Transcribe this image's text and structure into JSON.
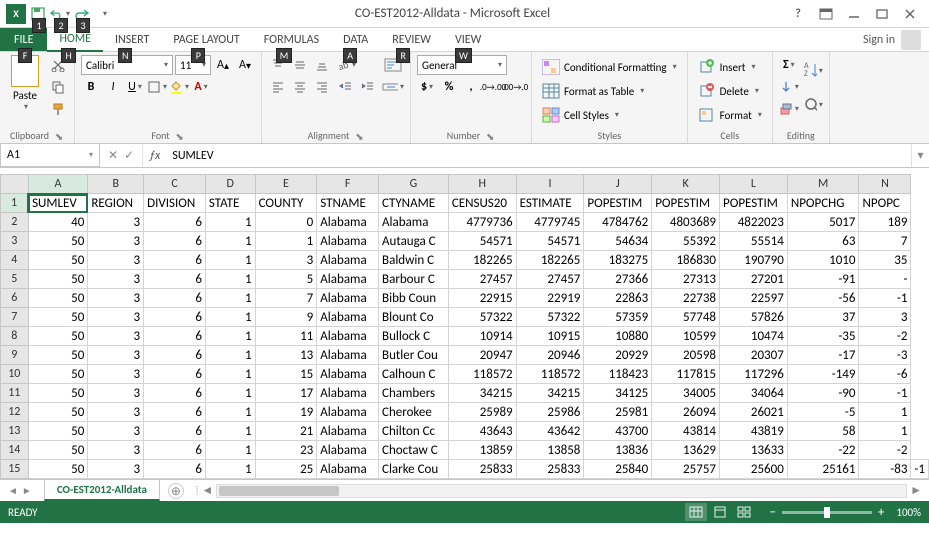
{
  "app": {
    "title": "CO-EST2012-Alldata - Microsoft Excel"
  },
  "qat": {
    "save_key": "1",
    "undo_key": "2",
    "redo_key": "3"
  },
  "tabs": {
    "file": {
      "label": "FILE",
      "key": "F"
    },
    "home": {
      "label": "HOME",
      "key": "H"
    },
    "insert": {
      "label": "INSERT",
      "key": "N"
    },
    "pagelayout": {
      "label": "PAGE LAYOUT",
      "key": "P"
    },
    "formulas": {
      "label": "FORMULAS",
      "key": "M"
    },
    "data": {
      "label": "DATA",
      "key": "A"
    },
    "review": {
      "label": "REVIEW",
      "key": "R"
    },
    "view": {
      "label": "VIEW",
      "key": "W"
    },
    "signin": "Sign in"
  },
  "ribbon": {
    "clipboard": {
      "paste": "Paste",
      "label": "Clipboard"
    },
    "font": {
      "name": "Calibri",
      "size": "11",
      "label": "Font"
    },
    "alignment": {
      "label": "Alignment"
    },
    "number": {
      "format": "General",
      "label": "Number"
    },
    "styles": {
      "cond": "Conditional Formatting",
      "table": "Format as Table",
      "cell": "Cell Styles",
      "label": "Styles"
    },
    "cells": {
      "insert": "Insert",
      "delete": "Delete",
      "format": "Format",
      "label": "Cells"
    },
    "editing": {
      "label": "Editing"
    }
  },
  "namebox": "A1",
  "formula_value": "SUMLEV",
  "columns": [
    "A",
    "B",
    "C",
    "D",
    "E",
    "F",
    "G",
    "H",
    "I",
    "J",
    "K",
    "L",
    "M",
    "N"
  ],
  "header_row": [
    "SUMLEV",
    "REGION",
    "DIVISION",
    "STATE",
    "COUNTY",
    "STNAME",
    "CTYNAME",
    "CENSUS20",
    "ESTIMATE",
    "POPESTIM",
    "POPESTIM",
    "POPESTIM",
    "NPOPCHG",
    "NPOPC"
  ],
  "data_rows": [
    [
      40,
      3,
      6,
      1,
      0,
      "Alabama",
      "Alabama",
      4779736,
      4779745,
      4784762,
      4803689,
      4822023,
      5017,
      "189"
    ],
    [
      50,
      3,
      6,
      1,
      1,
      "Alabama",
      "Autauga C",
      54571,
      54571,
      54634,
      55392,
      55514,
      63,
      "7"
    ],
    [
      50,
      3,
      6,
      1,
      3,
      "Alabama",
      "Baldwin C",
      182265,
      182265,
      183275,
      186830,
      190790,
      1010,
      "35"
    ],
    [
      50,
      3,
      6,
      1,
      5,
      "Alabama",
      "Barbour C",
      27457,
      27457,
      27366,
      27313,
      27201,
      -91,
      "-"
    ],
    [
      50,
      3,
      6,
      1,
      7,
      "Alabama",
      "Bibb Coun",
      22915,
      22919,
      22863,
      22738,
      22597,
      -56,
      "-1"
    ],
    [
      50,
      3,
      6,
      1,
      9,
      "Alabama",
      "Blount Co",
      57322,
      57322,
      57359,
      57748,
      57826,
      37,
      "3"
    ],
    [
      50,
      3,
      6,
      1,
      11,
      "Alabama",
      "Bullock C",
      10914,
      10915,
      10880,
      10599,
      10474,
      -35,
      "-2"
    ],
    [
      50,
      3,
      6,
      1,
      13,
      "Alabama",
      "Butler Cou",
      20947,
      20946,
      20929,
      20598,
      20307,
      -17,
      "-3"
    ],
    [
      50,
      3,
      6,
      1,
      15,
      "Alabama",
      "Calhoun C",
      118572,
      118572,
      118423,
      117815,
      117296,
      -149,
      "-6"
    ],
    [
      50,
      3,
      6,
      1,
      17,
      "Alabama",
      "Chambers",
      34215,
      34215,
      34125,
      34005,
      34064,
      -90,
      "-1"
    ],
    [
      50,
      3,
      6,
      1,
      19,
      "Alabama",
      "Cherokee",
      25989,
      25986,
      25981,
      26094,
      26021,
      -5,
      "1"
    ],
    [
      50,
      3,
      6,
      1,
      21,
      "Alabama",
      "Chilton Cc",
      43643,
      43642,
      43700,
      43814,
      43819,
      58,
      "1"
    ],
    [
      50,
      3,
      6,
      1,
      23,
      "Alabama",
      "Choctaw C",
      13859,
      13858,
      13836,
      13629,
      13633,
      -22,
      "-2"
    ],
    [
      50,
      3,
      6,
      1,
      25,
      "Alabama",
      "Clarke Cou",
      25833,
      25833,
      25840,
      25757,
      25600,
      25161,
      "-83",
      "-1"
    ]
  ],
  "sheet_tab": "CO-EST2012-Alldata",
  "status": {
    "ready": "READY",
    "zoom": "100%"
  }
}
